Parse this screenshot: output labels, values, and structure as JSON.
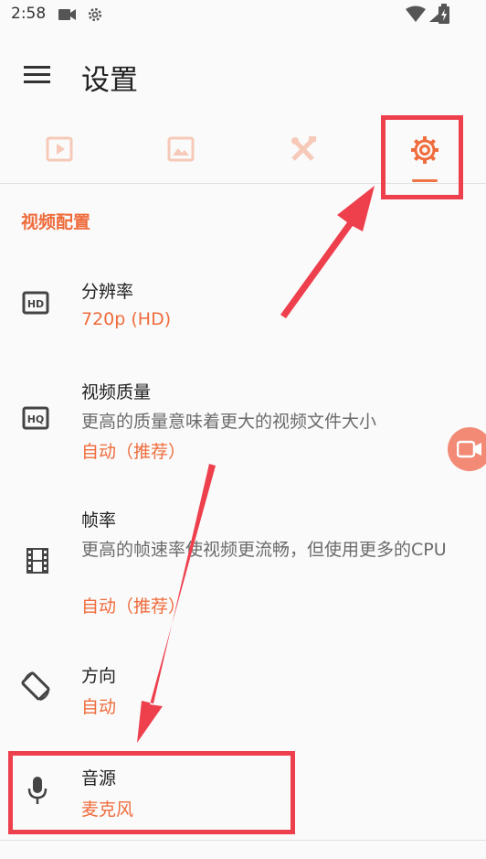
{
  "status": {
    "time": "2:58"
  },
  "header": {
    "title": "设置"
  },
  "tabs": [
    {
      "name": "video",
      "icon": "play-icon",
      "selected": false
    },
    {
      "name": "image",
      "icon": "image-icon",
      "selected": false
    },
    {
      "name": "tools",
      "icon": "tools-icon",
      "selected": false
    },
    {
      "name": "settings",
      "icon": "gear-icon",
      "selected": true
    }
  ],
  "section": {
    "title": "视频配置"
  },
  "prefs": {
    "resolution": {
      "title": "分辨率",
      "value": "720p (HD)",
      "icon": "hd-icon"
    },
    "quality": {
      "title": "视频质量",
      "summary": "更高的质量意味着更大的视频文件大小",
      "value": "自动（推荐）",
      "icon": "hq-icon"
    },
    "framerate": {
      "title": "帧率",
      "summary": "更高的帧速率使视频更流畅，但使用更多的CPU",
      "value": "自动（推荐）",
      "icon": "film-icon"
    },
    "orientation": {
      "title": "方向",
      "value": "自动",
      "icon": "screen-rotation-icon"
    },
    "audio": {
      "title": "音源",
      "value": "麦克风",
      "icon": "mic-icon"
    }
  },
  "colors": {
    "accent": "#ef6c3c",
    "annotation": "#ee3f4d",
    "tab_inactive": "#f6c9b8"
  }
}
